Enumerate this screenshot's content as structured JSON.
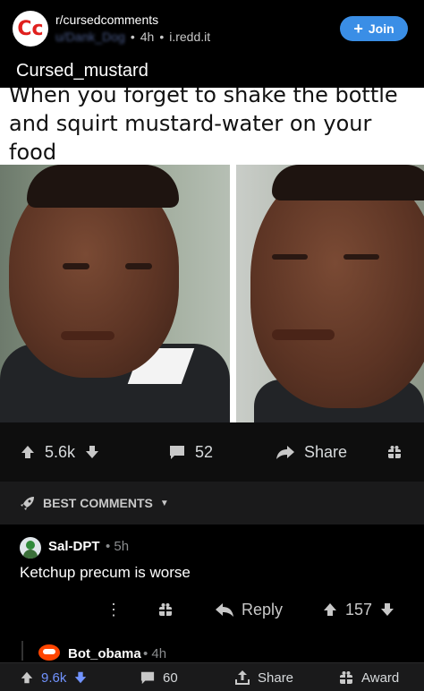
{
  "header": {
    "subreddit": "r/cursedcomments",
    "username_blurred": "u/Dank_Dog",
    "age": "4h",
    "domain": "i.redd.it",
    "join_label": "Join",
    "post_title": "Cursed_mustard"
  },
  "meme": {
    "caption": "When you forget to shake the bottle and squirt mustard-water on your food"
  },
  "post_actions": {
    "upvotes": "5.6k",
    "comments": "52",
    "share_label": "Share"
  },
  "sort": {
    "label": "BEST COMMENTS"
  },
  "comment": {
    "username": "Sal-DPT",
    "time": "5h",
    "body": "Ketchup precum is worse",
    "reply_label": "Reply",
    "votes": "157"
  },
  "reply_preview": {
    "username": "Bot_obama",
    "time": "4h"
  },
  "bottom_bar": {
    "votes": "9.6k",
    "comments": "60",
    "share_label": "Share",
    "award_label": "Award"
  },
  "colors": {
    "join_button": "#3a8ee6",
    "upvote_active": "#7193ff",
    "background": "#000000"
  }
}
